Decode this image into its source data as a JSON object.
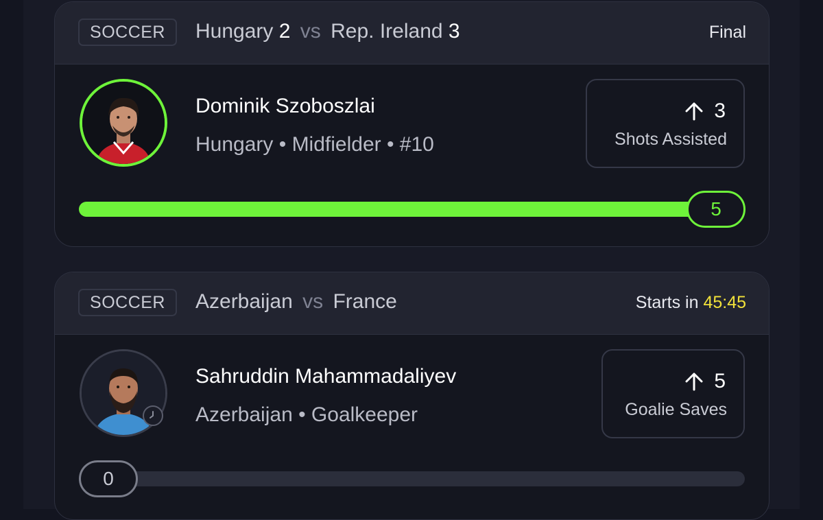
{
  "cards": [
    {
      "sport": "SOCCER",
      "home_team": "Hungary",
      "home_score": "2",
      "vs": "vs",
      "away_team": "Rep. Ireland",
      "away_score": "3",
      "status": "Final",
      "player": {
        "name": "Dominik Szoboszlai",
        "meta": "Hungary • Midfielder • #10"
      },
      "stat": {
        "direction_icon": "arrow-up-icon",
        "value": "3",
        "label": "Shots Assisted"
      },
      "progress": {
        "value": "5",
        "fraction": 1.0,
        "color": "#6ef33a"
      }
    },
    {
      "sport": "SOCCER",
      "home_team": "Azerbaijan",
      "vs": "vs",
      "away_team": "France",
      "status_prefix": "Starts in",
      "countdown": "45:45",
      "player": {
        "name": "Sahruddin Mahammadaliyev",
        "meta": "Azerbaijan • Goalkeeper"
      },
      "stat": {
        "direction_icon": "arrow-up-icon",
        "value": "5",
        "label": "Goalie Saves"
      },
      "progress": {
        "value": "0",
        "fraction": 0.0
      }
    }
  ],
  "colors": {
    "accent_green": "#6ef33a",
    "countdown_yellow": "#f2e23a",
    "card_bg": "#14161f",
    "header_bg": "#222430"
  }
}
